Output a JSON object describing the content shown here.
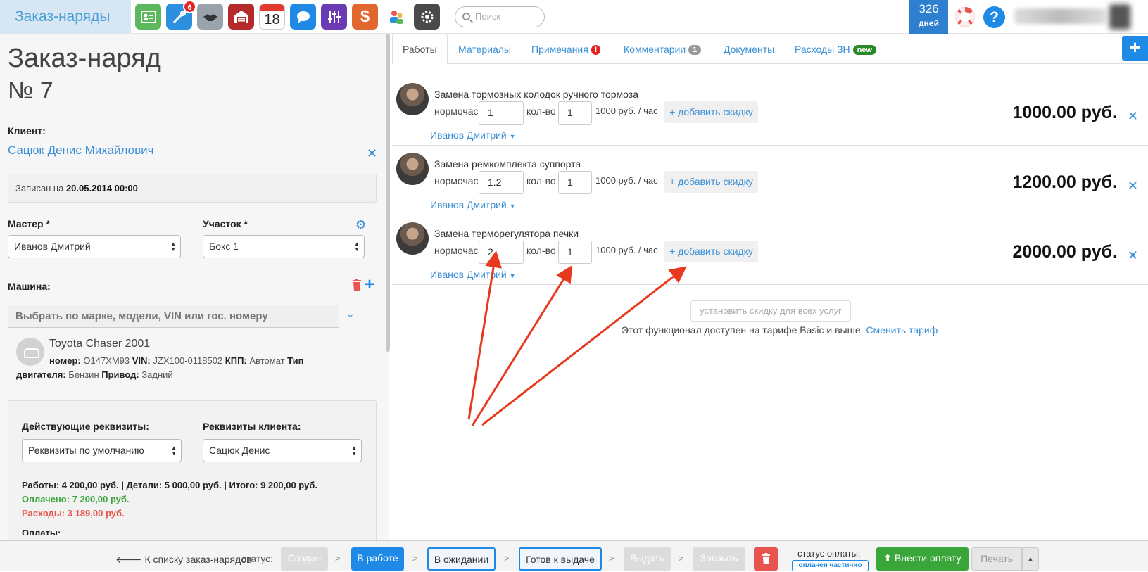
{
  "app": {
    "brand": "Заказ-наряды"
  },
  "topbar": {
    "badge_count": "6",
    "calendar_day": "18",
    "search_placeholder": "Поиск",
    "days_number": "326",
    "days_label": "дней",
    "help_label": "?"
  },
  "order": {
    "title": "Заказ-наряд",
    "number": "№  7",
    "client_label": "Клиент:",
    "client_name": "Сацюк Денис Михайлович",
    "recorded_prefix": "Записан на",
    "recorded_date": "20.05.2014 00:00",
    "master_label": "Мастер *",
    "master_value": "Иванов Дмитрий",
    "section_label": "Участок *",
    "section_value": "Бокс 1",
    "car_label": "Машина:",
    "car_placeholder": "Выбрать по марке, модели, VIN или гос. номеру",
    "car_title": "Toyota Chaser 2001",
    "car_number_label": "номер:",
    "car_number": "O147XM93",
    "car_vin_label": "VIN:",
    "car_vin": "JZX100-0118502",
    "car_kpp_label": "КПП:",
    "car_kpp": "Автомат",
    "car_engine_label": "Тип двигателя:",
    "car_engine": "Бензин",
    "car_drive_label": "Привод:",
    "car_drive": "Задний",
    "req_active_label": "Действующие реквизиты:",
    "req_active_value": "Реквизиты по умолчанию",
    "req_client_label": "Реквизиты клиента:",
    "req_client_value": "Сацюк Денис",
    "totals_line": "Работы: 4 200,00 руб. | Детали: 5 000,00 руб. | Итого: 9 200,00 руб.",
    "paid_line": "Оплачено: 7 200,00 руб.",
    "expenses_line": "Расходы: 3 189,00 руб.",
    "payments_label": "Оплаты:"
  },
  "tabs": [
    {
      "label": "Работы"
    },
    {
      "label": "Материалы"
    },
    {
      "label": "Примечания",
      "badge": "!"
    },
    {
      "label": "Комментарии",
      "badge": "1"
    },
    {
      "label": "Документы"
    },
    {
      "label": "Расходы ЗН",
      "badge": "new"
    }
  ],
  "works_labels": {
    "hours_label": "нормочас",
    "qty_label": "кол-во",
    "rate": "1000 руб. / час",
    "discount": "+ добавить скидку",
    "employee": "Иванов Дмитрий"
  },
  "works": [
    {
      "title": "Замена тормозных колодок ручного тормоза",
      "hours": "1",
      "qty": "1",
      "price": "1000.00 руб."
    },
    {
      "title": "Замена ремкомплекта суппорта",
      "hours": "1.2",
      "qty": "1",
      "price": "1200.00 руб."
    },
    {
      "title": "Замена терморегулятора печки",
      "hours": "2",
      "qty": "1",
      "price": "2000.00 руб."
    }
  ],
  "discount_all": "установить скидку для всех услуг",
  "tarif_text": "Этот функционал доступен на тарифе Basic и выше.",
  "tarif_link": "Сменить тариф",
  "bottom": {
    "back": "К списку заказ-нарядов",
    "status_label": "статус:",
    "statuses": [
      "Создан",
      "В работе",
      "В ожидании",
      "Готов к выдаче",
      "Выдать",
      "Закрыть"
    ],
    "payment_status_label": "статус оплаты:",
    "payment_status": "оплачен частично",
    "pay_button": "Внести оплату",
    "print_button": "Печать"
  },
  "colors": {
    "accent": "#1e8ae6",
    "link": "#3a8fd6",
    "success": "#3aa63a",
    "danger": "#e8554e",
    "annotation": "#e8391f"
  }
}
